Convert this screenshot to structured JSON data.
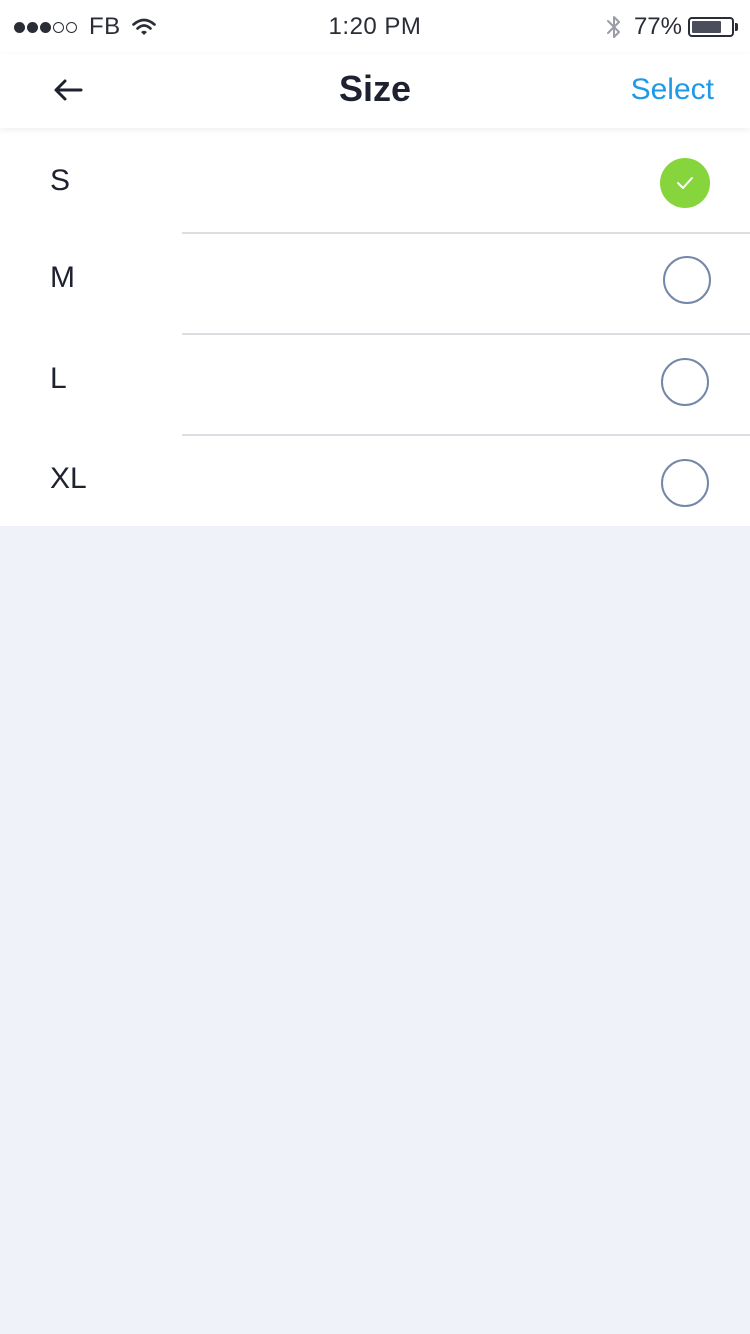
{
  "status_bar": {
    "carrier": "FB",
    "time": "1:20 PM",
    "battery_percent": "77%",
    "battery_level": 0.77,
    "signal_bars_filled": 3,
    "signal_bars_total": 5,
    "icons": [
      "wifi-icon",
      "bluetooth-icon",
      "battery-icon"
    ]
  },
  "nav": {
    "back_icon": "arrow-left-icon",
    "title": "Size",
    "select_label": "Select"
  },
  "sizes": [
    {
      "label": "S",
      "selected": true
    },
    {
      "label": "M",
      "selected": false
    },
    {
      "label": "L",
      "selected": false
    },
    {
      "label": "XL",
      "selected": false
    }
  ],
  "colors": {
    "accent_blue": "#1f9ae8",
    "selected_green": "#86d53c",
    "radio_border": "#7387a8",
    "background": "#f0f2fa",
    "text_dark": "#1e2230"
  }
}
